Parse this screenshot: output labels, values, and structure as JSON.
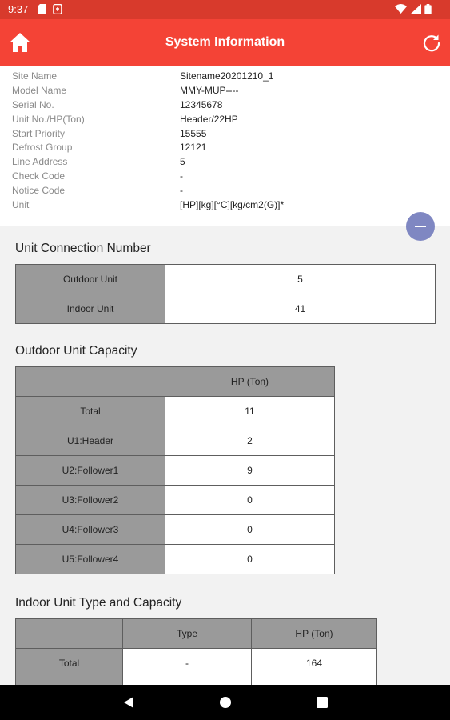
{
  "status_bar": {
    "time": "9:37"
  },
  "app_bar": {
    "title": "System Information"
  },
  "info": [
    {
      "label": "Site Name",
      "value": "Sitename20201210_1"
    },
    {
      "label": "Model Name",
      "value": "MMY-MUP----"
    },
    {
      "label": "Serial No.",
      "value": "12345678"
    },
    {
      "label": "Unit No./HP(Ton)",
      "value": "Header/22HP"
    },
    {
      "label": "Start Priority",
      "value": "15555"
    },
    {
      "label": "Defrost Group",
      "value": "12121"
    },
    {
      "label": "Line Address",
      "value": "5"
    },
    {
      "label": "Check Code",
      "value": "-"
    },
    {
      "label": "Notice Code",
      "value": "-"
    },
    {
      "label": "Unit",
      "value": "[HP][kg][°C][kg/cm2(G)]*"
    }
  ],
  "connection": {
    "title": "Unit Connection Number",
    "rows": [
      {
        "label": "Outdoor Unit",
        "value": "5"
      },
      {
        "label": "Indoor Unit",
        "value": "41"
      }
    ]
  },
  "outdoor_capacity": {
    "title": "Outdoor Unit Capacity",
    "header": "HP (Ton)",
    "rows": [
      {
        "label": "Total",
        "value": "11"
      },
      {
        "label": "U1:Header",
        "value": "2"
      },
      {
        "label": "U2:Follower1",
        "value": "9"
      },
      {
        "label": "U3:Follower2",
        "value": "0"
      },
      {
        "label": "U4:Follower3",
        "value": "0"
      },
      {
        "label": "U5:Follower4",
        "value": "0"
      }
    ]
  },
  "indoor_capacity": {
    "title": "Indoor Unit Type and Capacity",
    "headers": [
      "Type",
      "HP (Ton)"
    ],
    "rows": [
      {
        "label": "Total",
        "type": "-",
        "hp": "164"
      }
    ]
  }
}
